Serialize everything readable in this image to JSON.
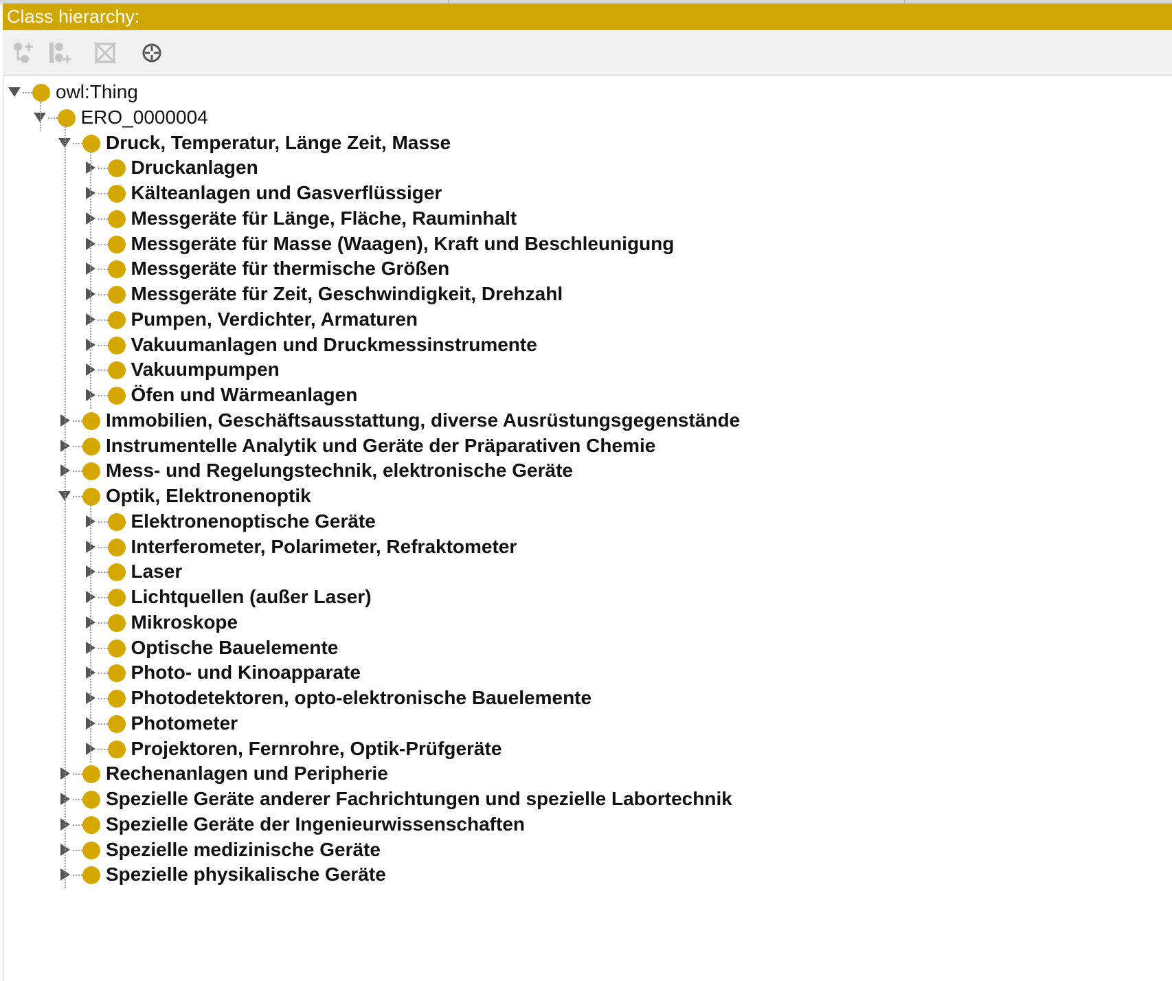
{
  "panel": {
    "title": "Class hierarchy:"
  },
  "toolbar": {
    "buttons": [
      {
        "icon": "add-subclass-icon",
        "enabled": false
      },
      {
        "icon": "add-sibling-class-icon",
        "enabled": false
      },
      {
        "icon": "delete-class-icon",
        "enabled": false
      },
      {
        "icon": "target-icon",
        "enabled": true
      }
    ]
  },
  "colors": {
    "header": "#d0a600",
    "class_dot": "#d4a800"
  },
  "tree": {
    "root": {
      "label": "owl:Thing",
      "expanded": true
    },
    "ero": {
      "label": "ERO_0000004",
      "expanded": true
    },
    "groups": [
      {
        "label": "Druck, Temperatur, Länge Zeit, Masse",
        "expanded": true,
        "children": [
          "Druckanlagen",
          "Kälteanlagen und Gasverflüssiger",
          "Messgeräte für Länge, Fläche, Rauminhalt",
          "Messgeräte für Masse (Waagen), Kraft und Beschleunigung",
          "Messgeräte für thermische Größen",
          "Messgeräte für Zeit, Geschwindigkeit, Drehzahl",
          "Pumpen, Verdichter, Armaturen",
          "Vakuumanlagen und Druckmessinstrumente",
          "Vakuumpumpen",
          "Öfen und Wärmeanlagen"
        ]
      },
      {
        "label": "Immobilien, Geschäftsausstattung, diverse Ausrüstungsgegenstände",
        "expanded": false,
        "children": []
      },
      {
        "label": "Instrumentelle Analytik und Geräte der Präparativen Chemie",
        "expanded": false,
        "children": []
      },
      {
        "label": "Mess- und Regelungstechnik, elektronische Geräte",
        "expanded": false,
        "children": []
      },
      {
        "label": "Optik, Elektronenoptik",
        "expanded": true,
        "children": [
          "Elektronenoptische Geräte",
          "Interferometer, Polarimeter, Refraktometer",
          "Laser",
          "Lichtquellen (außer Laser)",
          "Mikroskope",
          "Optische Bauelemente",
          "Photo- und Kinoapparate",
          "Photodetektoren, opto-elektronische Bauelemente",
          "Photometer",
          "Projektoren, Fernrohre, Optik-Prüfgeräte"
        ]
      },
      {
        "label": "Rechenanlagen und Peripherie",
        "expanded": false,
        "children": []
      },
      {
        "label": "Spezielle Geräte anderer Fachrichtungen und spezielle Labortechnik",
        "expanded": false,
        "children": []
      },
      {
        "label": "Spezielle Geräte der Ingenieurwissenschaften",
        "expanded": false,
        "children": []
      },
      {
        "label": "Spezielle medizinische Geräte",
        "expanded": false,
        "children": []
      },
      {
        "label": "Spezielle physikalische Geräte",
        "expanded": false,
        "children": []
      }
    ]
  }
}
